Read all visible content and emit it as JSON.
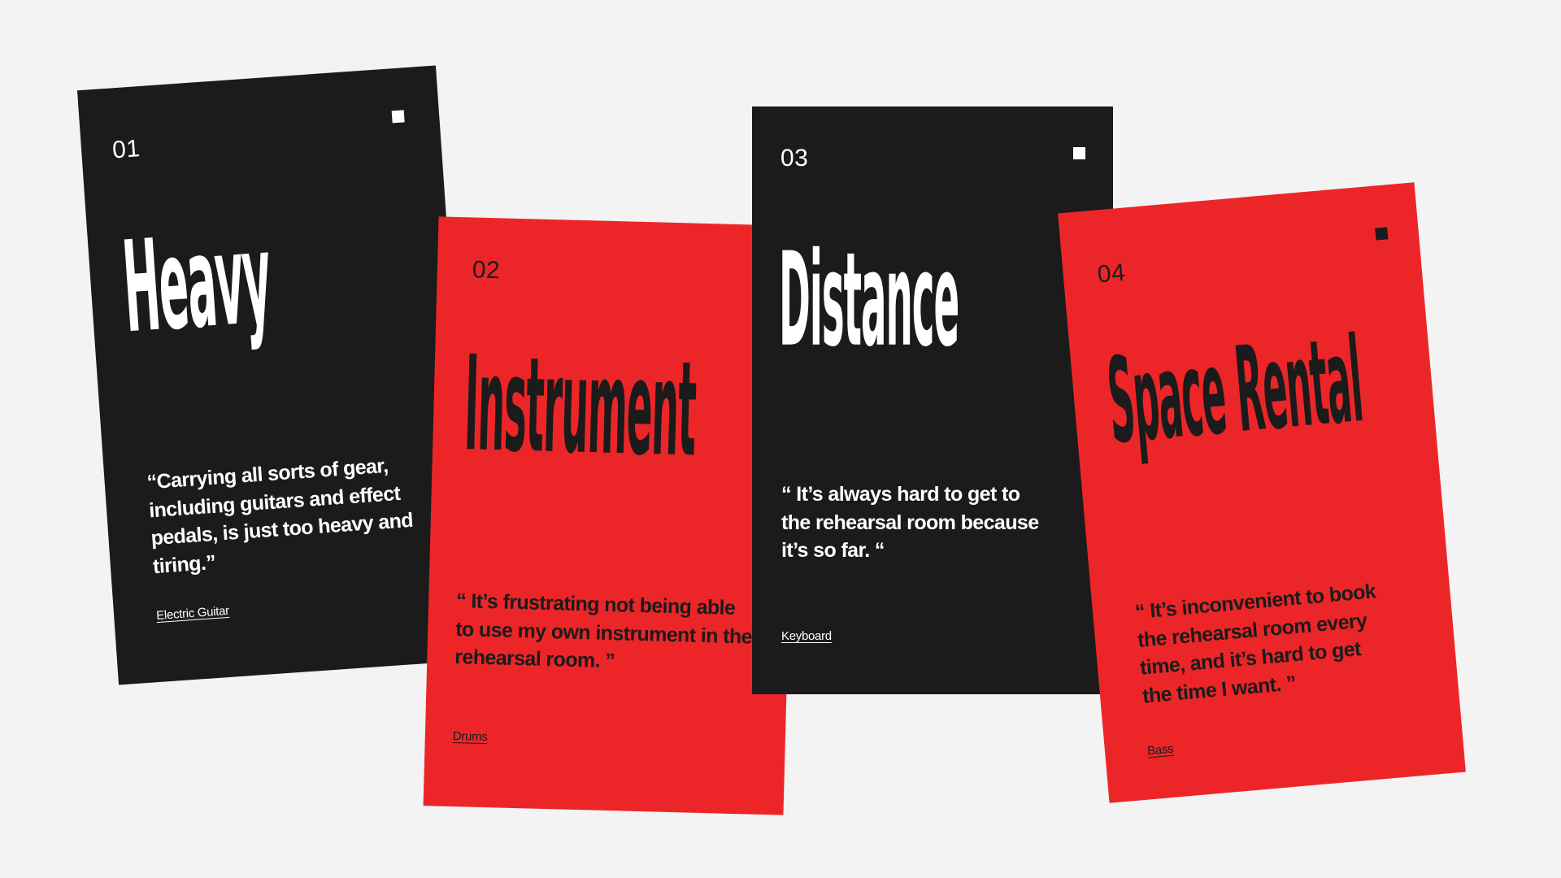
{
  "cards": [
    {
      "number": "01",
      "title": "Heavy",
      "quote": "“Carrying all sorts of gear, including guitars and effect pedals, is just too heavy and tiring.”",
      "tag": "Electric Guitar"
    },
    {
      "number": "02",
      "title": "Instrument",
      "quote": "“ It’s frustrating not being able to use my own instrument in the rehearsal room. ”",
      "tag": "Drums"
    },
    {
      "number": "03",
      "title": "Distance",
      "quote": "“ It’s always hard to get to the rehearsal room because it’s so far. “",
      "tag": "Keyboard"
    },
    {
      "number": "04",
      "title": "Space Rental",
      "quote": "“ It’s inconvenient to book the rehearsal room every time, and it’s hard to get the time I want. ”",
      "tag": "Bass"
    }
  ],
  "colors": {
    "background": "#f3f3f3",
    "black_card": "#1b1b1b",
    "red_card": "#ec2628",
    "white": "#ffffff"
  }
}
